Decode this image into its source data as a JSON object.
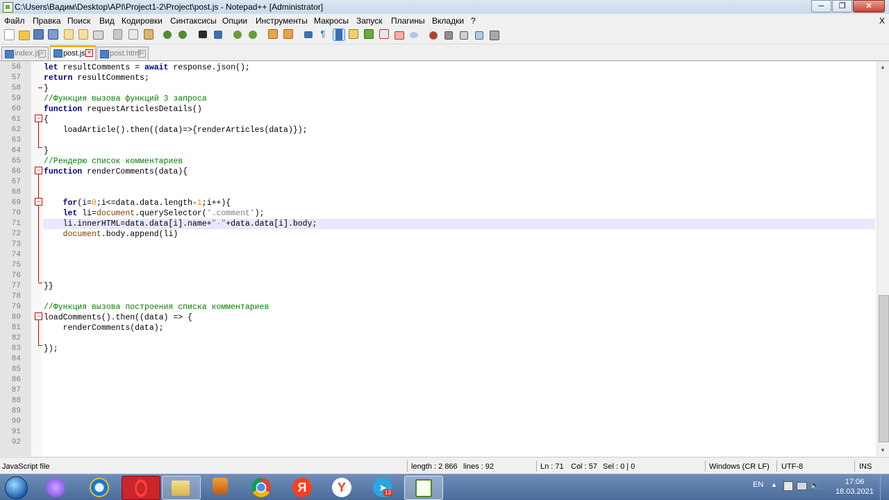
{
  "window": {
    "title": "C:\\Users\\Вадим\\Desktop\\API\\Project1-2\\Project\\post.js - Notepad++ [Administrator]",
    "minimize": "─",
    "restore": "❐",
    "close": "✕"
  },
  "menu": {
    "items": [
      "Файл",
      "Правка",
      "Поиск",
      "Вид",
      "Кодировки",
      "Синтаксисы",
      "Опции",
      "Инструменты",
      "Макросы",
      "Запуск",
      "Плагины",
      "Вкладки",
      "?"
    ],
    "close": "X"
  },
  "tabs": [
    {
      "label": "index.js",
      "active": false
    },
    {
      "label": "post.js",
      "active": true
    },
    {
      "label": "post.html",
      "active": false
    }
  ],
  "editor": {
    "current_line": 71,
    "lines": [
      {
        "n": "56",
        "html": "<span class=\"kw\">let</span> resultComments = <span class=\"kw\">await</span> response.json();"
      },
      {
        "n": "57",
        "html": "<span class=\"kw\">return</span> resultComments;"
      },
      {
        "n": "58",
        "html": "}"
      },
      {
        "n": "59",
        "html": "<span class=\"cm\">//Функция вызова функций 3 запроса</span>"
      },
      {
        "n": "60",
        "html": "<span class=\"kw\">function</span> requestArticlesDetails()"
      },
      {
        "n": "61",
        "html": "{"
      },
      {
        "n": "62",
        "html": "    loadArticle().then((data)=>{renderArticles(data)});"
      },
      {
        "n": "63",
        "html": ""
      },
      {
        "n": "64",
        "html": "}"
      },
      {
        "n": "65",
        "html": "<span class=\"cm\">//Рендерю список комментариев</span>"
      },
      {
        "n": "66",
        "html": "<span class=\"kw\">function</span> renderComments(data){"
      },
      {
        "n": "67",
        "html": ""
      },
      {
        "n": "68",
        "html": ""
      },
      {
        "n": "69",
        "html": "    <span class=\"kw\">for</span>(i=<span class=\"num\">0</span>;i&lt;=data.data.length-<span class=\"num\">1</span>;i++){"
      },
      {
        "n": "70",
        "html": "    <span class=\"kw\">let</span> li=<span class=\"obj\">document</span>.querySelector(<span class=\"str\">'.comment'</span>);"
      },
      {
        "n": "71",
        "html": "    li.innerHTML=data.data[i].name+<span class=\"str\">\"-\"</span>+data.data[i].body;"
      },
      {
        "n": "72",
        "html": "    <span class=\"obj\">document</span>.body.append(li)"
      },
      {
        "n": "73",
        "html": ""
      },
      {
        "n": "74",
        "html": ""
      },
      {
        "n": "75",
        "html": ""
      },
      {
        "n": "76",
        "html": ""
      },
      {
        "n": "77",
        "html": "}}"
      },
      {
        "n": "78",
        "html": ""
      },
      {
        "n": "79",
        "html": "<span class=\"cm\">//Функция вызова построения списка комментариев</span>"
      },
      {
        "n": "80",
        "html": "loadComments().then((data) =&gt; {"
      },
      {
        "n": "81",
        "html": "    renderComments(data);"
      },
      {
        "n": "82",
        "html": ""
      },
      {
        "n": "83",
        "html": "});"
      },
      {
        "n": "84",
        "html": ""
      },
      {
        "n": "85",
        "html": ""
      },
      {
        "n": "86",
        "html": ""
      },
      {
        "n": "87",
        "html": ""
      },
      {
        "n": "88",
        "html": ""
      },
      {
        "n": "89",
        "html": ""
      },
      {
        "n": "90",
        "html": ""
      },
      {
        "n": "91",
        "html": ""
      },
      {
        "n": "92",
        "html": ""
      }
    ]
  },
  "status": {
    "file_type": "JavaScript file",
    "length": "length : 2 866",
    "lines": "lines : 92",
    "ln": "Ln : 71",
    "col": "Col : 57",
    "sel": "Sel : 0 | 0",
    "eol": "Windows (CR LF)",
    "encoding": "UTF-8",
    "mode": "INS"
  },
  "taskbar": {
    "lang": "EN",
    "time": "17:06",
    "date": "18.03.2021",
    "telegram_badge": "13",
    "apps": [
      "alice-icon",
      "internet-explorer-icon",
      "opera-icon",
      "file-explorer-icon",
      "media-player-icon",
      "chrome-icon",
      "yandex-icon",
      "yandex-browser-icon",
      "telegram-icon",
      "notepad-plus-plus-icon"
    ]
  },
  "colors": {
    "keyword": "#000080",
    "comment": "#008000",
    "number": "#ff8000",
    "string": "#808080",
    "current_line": "#e8e8ff",
    "fold": "#cc0000"
  }
}
